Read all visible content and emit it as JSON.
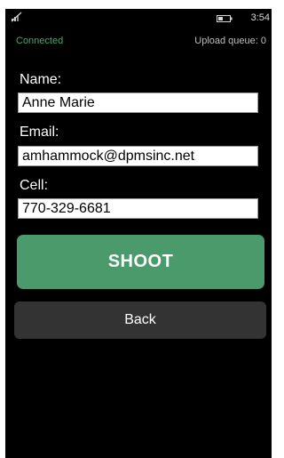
{
  "status_bar": {
    "signal_icon": "signal-icon",
    "battery_icon": "battery-icon",
    "time": "3:54"
  },
  "connection": {
    "status": "Connected",
    "upload_queue": "Upload queue: 0"
  },
  "form": {
    "name_label": "Name:",
    "name_value": "Anne Marie",
    "email_label": "Email:",
    "email_value": "amhammock@dpmsinc.net",
    "cell_label": "Cell:",
    "cell_value": "770-329-6681"
  },
  "buttons": {
    "shoot_label": "SHOOT",
    "back_label": "Back"
  },
  "colors": {
    "connected": "#3fae6e",
    "shoot_button": "#4b9a6c",
    "back_button": "#333333",
    "background": "#000000"
  }
}
